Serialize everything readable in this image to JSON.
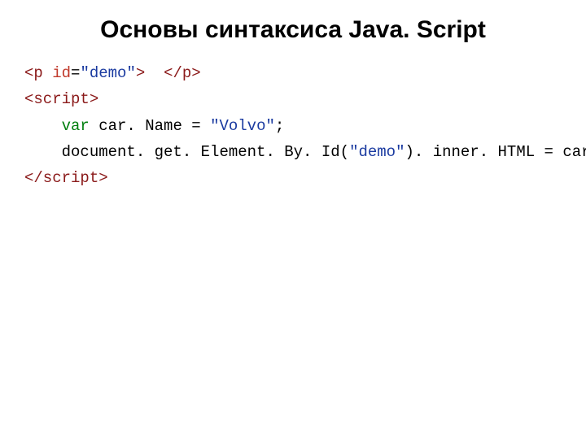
{
  "title": "Основы синтаксиса Java. Script",
  "code": {
    "line1_open1": "<p",
    "line1_attr": " id",
    "line1_eq": "=",
    "line1_val": "\"demo\"",
    "line1_close1": ">",
    "line1_spaces": "  ",
    "line1_open2": "</p>",
    "line2": "<script>",
    "line3_indent": "    ",
    "line3_var": "var",
    "line3_a": " car. Name = ",
    "line3_str": "\"Volvo\"",
    "line3_semi": ";",
    "line4_indent": "    ",
    "line4_a": "document. get. Element. By. Id(",
    "line4_str": "\"demo\"",
    "line4_b": "). inner. HTML = car. Name;",
    "line5": "</scr",
    "line5b": "ipt>"
  }
}
